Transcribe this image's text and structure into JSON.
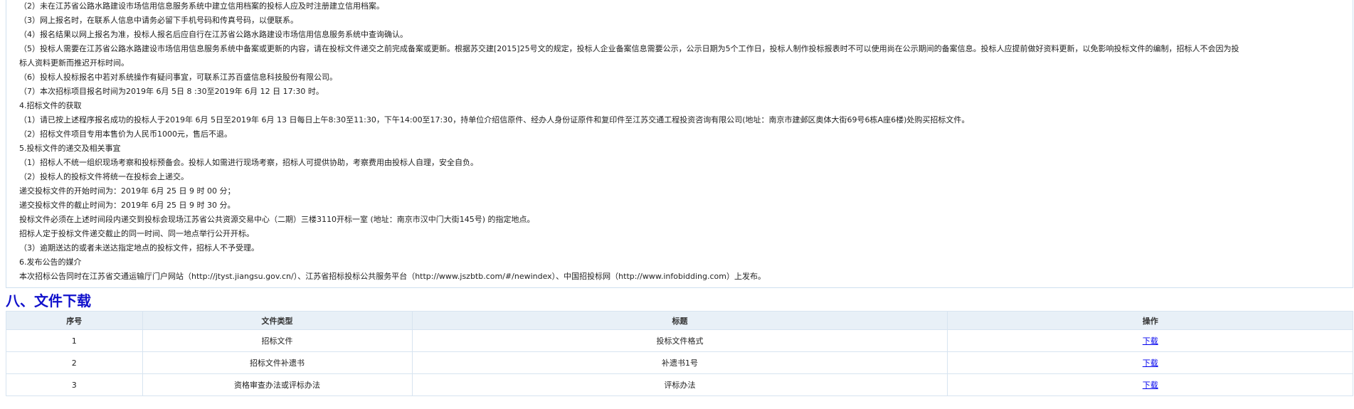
{
  "notice": {
    "lines": [
      "（2）未在江苏省公路水路建设市场信用信息服务系统中建立信用档案的投标人应及时注册建立信用档案。",
      "（3）网上报名时，在联系人信息中请务必留下手机号码和传真号码，以便联系。",
      "（4）报名结果以网上报名为准，投标人报名后应自行在江苏省公路水路建设市场信用信息服务系统中查询确认。",
      "（5）投标人需要在江苏省公路水路建设市场信用信息服务系统中备案或更新的内容，请在投标文件递交之前完成备案或更新。根据苏交建[2015]25号文的规定，投标人企业备案信息需要公示，公示日期为5个工作日，投标人制作投标报表时不可以使用尚在公示期间的备案信息。投标人应提前做好资料更新，以免影响投标文件的编制，招标人不会因为投",
      "标人资料更新而推迟开标时间。",
      "（6）投标人投标报名中若对系统操作有疑问事宜，可联系江苏百盛信息科技股份有限公司。",
      "（7）本次招标项目报名时间为2019年 6月 5日 8 :30至2019年 6月 12 日 17:30 时。",
      "4.招标文件的获取",
      "（1）请已按上述程序报名成功的投标人于2019年 6月 5日至2019年 6月 13 日每日上午8:30至11:30，下午14:00至17:30，持单位介绍信原件、经办人身份证原件和复印件至江苏交通工程投资咨询有限公司(地址：南京市建邺区奥体大街69号6栋A座6楼)处购买招标文件。",
      "（2）招标文件项目专用本售价为人民币1000元，售后不退。",
      "5.投标文件的递交及相关事宜",
      "（1）招标人不统一组织现场考察和投标预备会。投标人如需进行现场考察，招标人可提供协助，考察费用由投标人自理，安全自负。",
      "（2）投标人的投标文件将统一在投标会上递交。",
      "递交投标文件的开始时间为：2019年 6月 25 日 9 时 00 分；",
      "递交投标文件的截止时间为：2019年 6月 25 日 9 时 30 分。",
      "投标文件必须在上述时间段内递交到投标会现场江苏省公共资源交易中心（二期）三楼3110开标一室 (地址：南京市汉中门大街145号) 的指定地点。",
      "招标人定于投标文件递交截止的同一时间、同一地点举行公开开标。",
      "（3）逾期送达的或者未送达指定地点的投标文件，招标人不予受理。",
      "6.发布公告的媒介",
      "本次招标公告同时在江苏省交通运输厅门户网站（http://jtyst.jiangsu.gov.cn/）、江苏省招标投标公共服务平台（http://www.jszbtb.com/#/newindex）、中国招投标网（http://www.infobidding.com）上发布。"
    ]
  },
  "downloads": {
    "section_title": "八、文件下载",
    "headers": {
      "no": "序号",
      "type": "文件类型",
      "title": "标题",
      "action": "操作"
    },
    "rows": [
      {
        "no": "1",
        "type": "招标文件",
        "title": "投标文件格式",
        "action": "下载"
      },
      {
        "no": "2",
        "type": "招标文件补遗书",
        "title": "补遗书1号",
        "action": "下载"
      },
      {
        "no": "3",
        "type": "资格审查办法或评标办法",
        "title": "评标办法",
        "action": "下载"
      }
    ]
  },
  "colors": {
    "section_title": "#1111cc",
    "link": "#0000ee",
    "header_bg": "#e8f0f7",
    "border": "#d7e4f0"
  }
}
